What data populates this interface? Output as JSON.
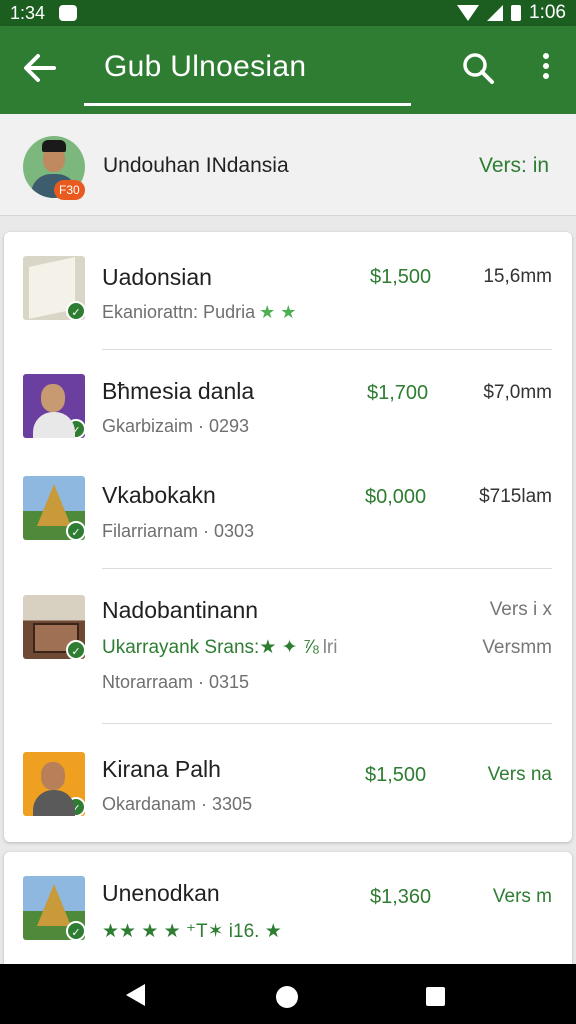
{
  "status_bar": {
    "time": "1:34",
    "right_time": "1:06",
    "icons": [
      "notification-icon",
      "wifi-icon",
      "signal-icon",
      "battery-icon"
    ]
  },
  "app_bar": {
    "title": "Gub Ulnoesian",
    "icons": [
      "back-arrow-icon",
      "search-icon",
      "more-vert-icon"
    ]
  },
  "user": {
    "name": "Undouhan INdansia",
    "badge": "F30",
    "version": "Vers: in"
  },
  "items": [
    {
      "title": "Uadonsian",
      "sub": "Ekaniorattn: Pudria",
      "stars": "★ ★",
      "price": "$1,500",
      "right": "15,6mm"
    },
    {
      "title": "Bħmesia danla",
      "sub": "Gkarbizaim · 0293",
      "price": "$1,700",
      "right": "$7,0mm"
    },
    {
      "title": "Vkabokakn",
      "sub": "Filarriarnam · 0303",
      "price": "$0,000",
      "right": "$715lam"
    },
    {
      "title": "Nadobantinann",
      "sub_green": "Ukarrayank Srans:★ ✦ ⅞",
      "sub_green_tail": "lri",
      "sub": "Ntorarraam · 0315",
      "right_top": "Vers i x",
      "right_bottom": "Versmm"
    },
    {
      "title": "Kirana Palh",
      "sub": "Okardanam · 3305",
      "price": "$1,500",
      "right": "Vers na"
    },
    {
      "title": "Unenodkan",
      "stars": "★★ ★ ★ ⁺T✶ i16. ★",
      "price": "$1,360",
      "right": "Vers m"
    }
  ],
  "colors": {
    "primary": "#2e7d32",
    "primary_dark": "#1b5e20",
    "accent": "#e85a1d"
  }
}
